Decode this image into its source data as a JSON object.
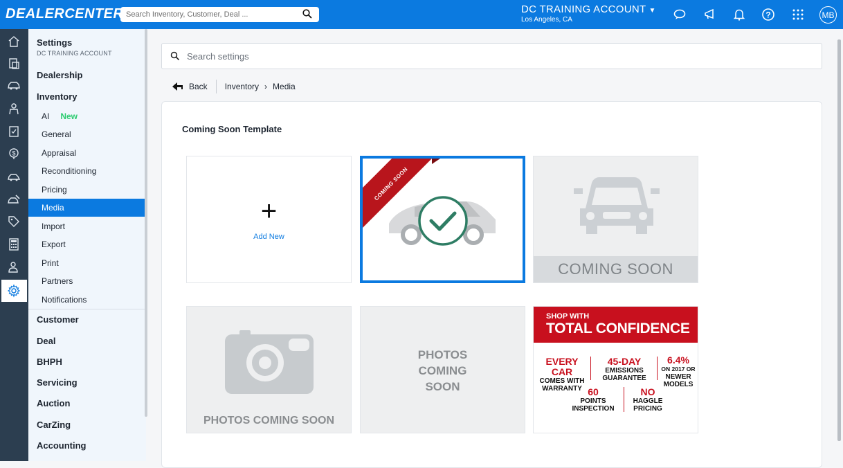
{
  "topbar": {
    "logo": "DEALERCENTER",
    "search_placeholder": "Search Inventory, Customer, Deal ...",
    "account_name": "DC TRAINING ACCOUNT",
    "account_location": "Los Angeles, CA",
    "avatar_initials": "MB",
    "accent": "#0b7ae0"
  },
  "sidebar": {
    "title": "Settings",
    "subtitle": "DC TRAINING ACCOUNT",
    "sections": {
      "dealership": "Dealership",
      "inventory": "Inventory",
      "customer": "Customer",
      "deal": "Deal",
      "bhph": "BHPH",
      "servicing": "Servicing",
      "auction": "Auction",
      "carzing": "CarZing",
      "accounting": "Accounting"
    },
    "inventory_items": [
      {
        "label": "AI",
        "badge": "New"
      },
      {
        "label": "General"
      },
      {
        "label": "Appraisal"
      },
      {
        "label": "Reconditioning"
      },
      {
        "label": "Pricing"
      },
      {
        "label": "Media",
        "selected": true
      },
      {
        "label": "Import"
      },
      {
        "label": "Export"
      },
      {
        "label": "Print"
      },
      {
        "label": "Partners"
      },
      {
        "label": "Notifications"
      }
    ],
    "rail_icons": [
      "home-icon",
      "inventory-icon",
      "car-icon",
      "customer-icon",
      "deal-icon",
      "bhph-icon",
      "servicing-icon",
      "auction-icon",
      "tag-icon",
      "calculator-icon",
      "user-settings-icon",
      "gear-icon"
    ]
  },
  "main": {
    "search_placeholder": "Search settings",
    "breadcrumb": {
      "back": "Back",
      "section": "Inventory",
      "page": "Media"
    },
    "card_title": "Coming Soon Template",
    "tiles": {
      "add_new": "Add New",
      "coming_soon_ribbon": "COMING SOON",
      "coming_soon_band": "COMING SOON",
      "photos_coming_soon": "PHOTOS COMING SOON",
      "photos_stack": [
        "PHOTOS",
        "COMING",
        "SOON"
      ],
      "promo": {
        "shop_with": "SHOP WITH",
        "total_confidence": "TOTAL CONFIDENCE",
        "every_car": "EVERY CAR",
        "comes_with": "COMES WITH",
        "warranty": "WARRANTY",
        "day45": "45-DAY",
        "emissions": "EMISSIONS",
        "guarantee": "GUARANTEE",
        "pct": "6.4%",
        "on2017": "ON 2017 OR",
        "newer": "NEWER",
        "models": "MODELS",
        "sixty": "60",
        "points": "POINTS",
        "inspection": "INSPECTION",
        "no": "NO",
        "haggle": "HAGGLE",
        "pricing": "PRICING"
      }
    }
  }
}
